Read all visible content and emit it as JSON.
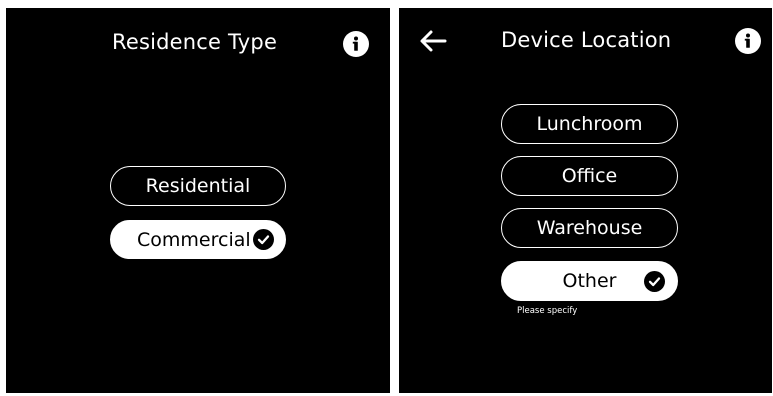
{
  "residence_screen": {
    "title": "Residence Type",
    "info_icon": "info-icon",
    "options": [
      {
        "label": "Residential",
        "selected": false
      },
      {
        "label": "Commercial",
        "selected": true
      }
    ]
  },
  "location_screen": {
    "title": "Device Location",
    "back_icon": "arrow-left-icon",
    "info_icon": "info-icon",
    "options": [
      {
        "label": "Lunchroom",
        "selected": false
      },
      {
        "label": "Office",
        "selected": false
      },
      {
        "label": "Warehouse",
        "selected": false
      },
      {
        "label": "Other",
        "selected": true
      }
    ],
    "hint": "Please specify"
  },
  "colors": {
    "background": "#000000",
    "foreground": "#ffffff"
  }
}
